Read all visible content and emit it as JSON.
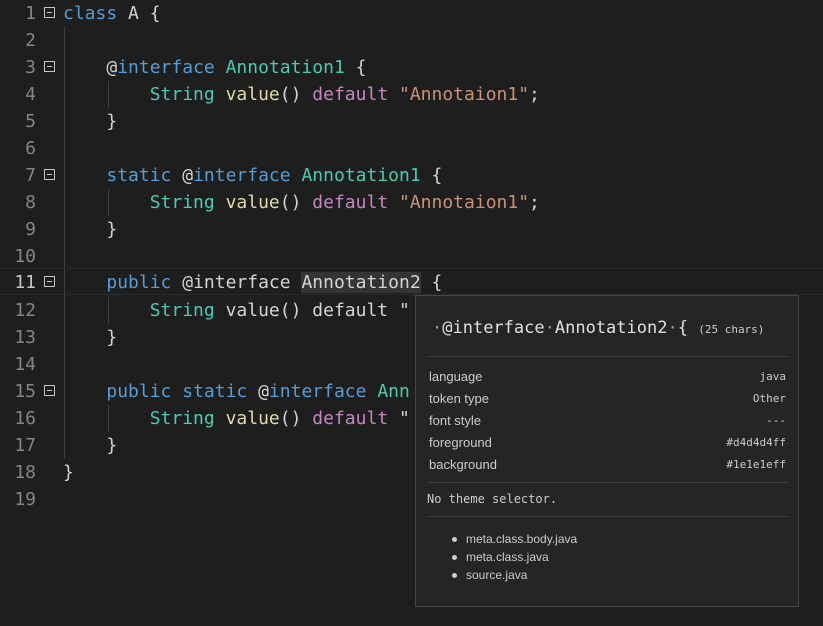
{
  "editor": {
    "lines": [
      {
        "n": "1",
        "t1": "class",
        "t2": " A {"
      },
      {
        "n": "2"
      },
      {
        "n": "3",
        "a": "@",
        "b": "interface",
        "c": "Annotation1",
        "d": " {"
      },
      {
        "n": "4",
        "a": "String",
        "b": "value",
        "c": "()",
        "d": "default",
        "e": "\"Annotaion1\"",
        "f": ";"
      },
      {
        "n": "5",
        "t": "}"
      },
      {
        "n": "6"
      },
      {
        "n": "7",
        "a": "static",
        "b": "@",
        "c": "interface",
        "d": "Annotation1",
        "e": " {"
      },
      {
        "n": "8",
        "a": "String",
        "b": "value",
        "c": "()",
        "d": "default",
        "e": "\"Annotaion1\"",
        "f": ";"
      },
      {
        "n": "9",
        "t": "}"
      },
      {
        "n": "10"
      },
      {
        "n": "11",
        "a": "public",
        "b": "@interface",
        "c": "Annotation2",
        "d": " {"
      },
      {
        "n": "12",
        "a": "String",
        "b": "value() default",
        "c": "\""
      },
      {
        "n": "13",
        "t": "}"
      },
      {
        "n": "14"
      },
      {
        "n": "15",
        "a": "public",
        "b": "static",
        "c": "@",
        "d": "interface",
        "e": "Ann"
      },
      {
        "n": "16",
        "a": "String",
        "b": "value",
        "c": "()",
        "d": "default",
        "e": "\""
      },
      {
        "n": "17",
        "t": "}"
      },
      {
        "n": "18",
        "t": "}"
      },
      {
        "n": "19"
      }
    ]
  },
  "hover": {
    "token": "@interface",
    "token2": "Annotation2",
    "token3": "{",
    "char_count": "(25 chars)",
    "rows": [
      {
        "key": "language",
        "value": "java"
      },
      {
        "key": "token type",
        "value": "Other"
      },
      {
        "key": "font style",
        "value": "---"
      },
      {
        "key": "foreground",
        "value": "#d4d4d4ff"
      },
      {
        "key": "background",
        "value": "#1e1e1eff"
      }
    ],
    "note": "No theme selector.",
    "scopes": [
      "meta.class.body.java",
      "meta.class.java",
      "source.java"
    ]
  }
}
